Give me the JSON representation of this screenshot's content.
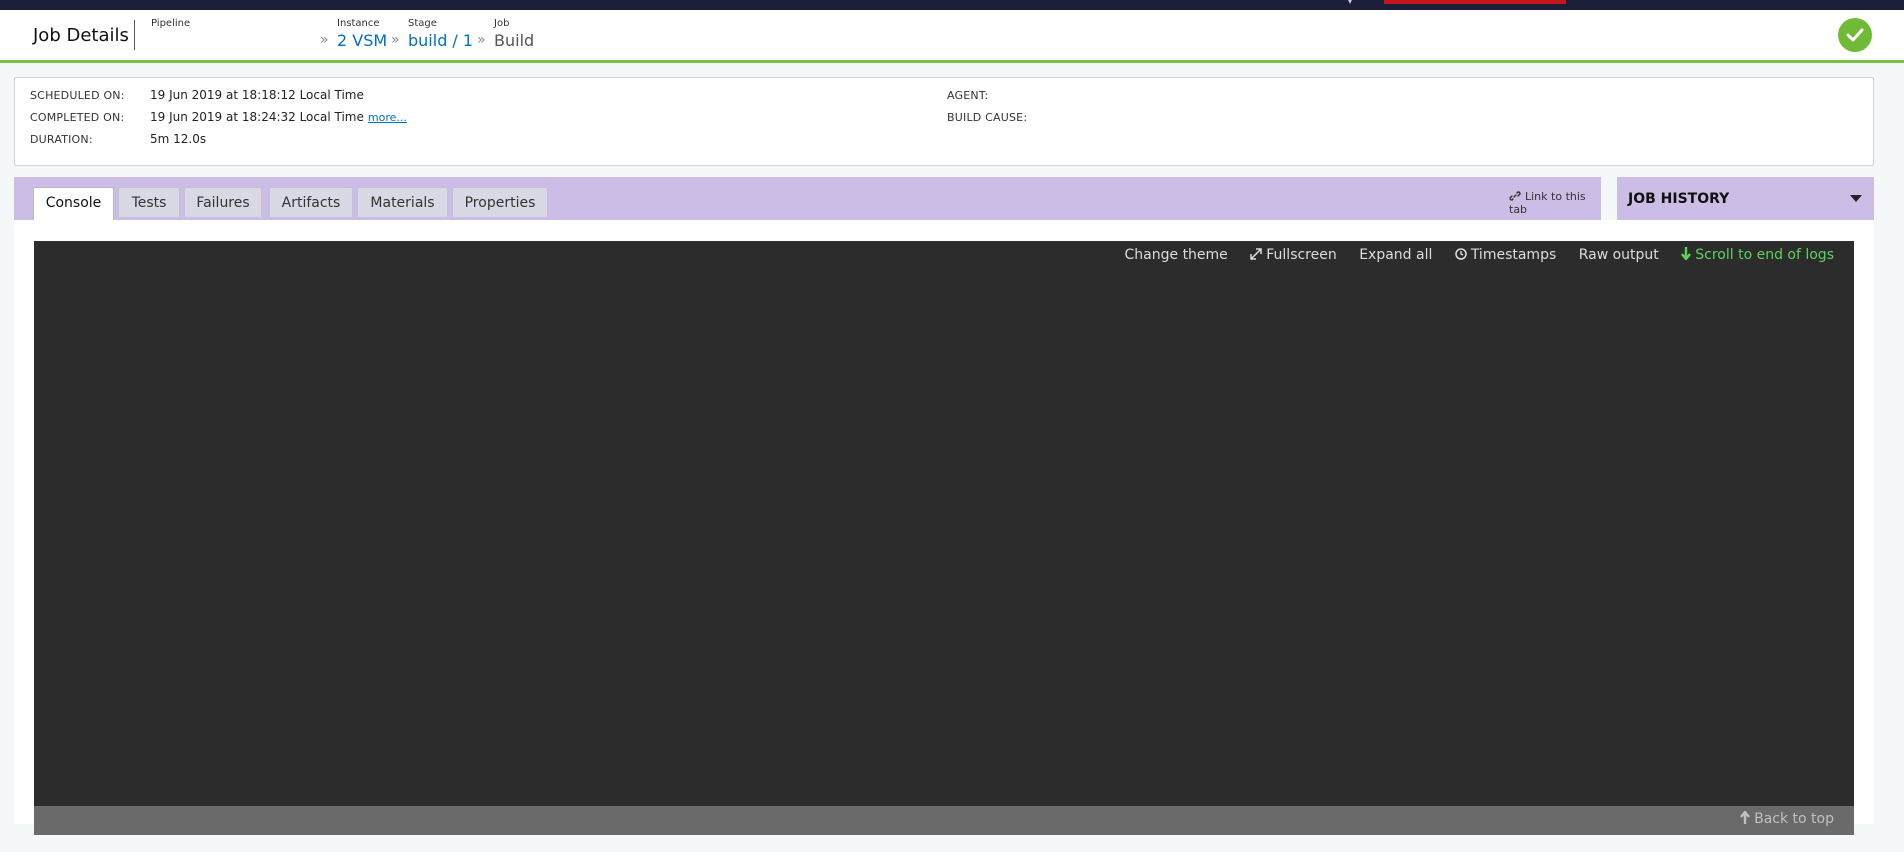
{
  "header": {
    "title": "Job Details",
    "breadcrumb": {
      "pipeline_label": "Pipeline",
      "instance_label": "Instance",
      "instance_value": "2 VSM",
      "stage_label": "Stage",
      "stage_value": "build / 1",
      "job_label": "Job",
      "job_value": "Build",
      "separator": "»"
    },
    "status": "passed",
    "status_icon": "check-icon"
  },
  "info": {
    "scheduled_label": "SCHEDULED ON:",
    "scheduled_value": "19 Jun 2019 at 18:18:12 Local Time",
    "completed_label": "COMPLETED ON:",
    "completed_value": "19 Jun 2019 at 18:24:32 Local Time",
    "more_link": "more...",
    "duration_label": "DURATION:",
    "duration_value": "5m 12.0s",
    "agent_label": "AGENT:",
    "agent_value": "",
    "build_cause_label": "BUILD CAUSE:",
    "build_cause_value": ""
  },
  "tabs": [
    {
      "label": "Console",
      "active": true
    },
    {
      "label": "Tests",
      "active": false
    },
    {
      "label": "Failures",
      "active": false
    },
    {
      "label": "Artifacts",
      "active": false
    },
    {
      "label": "Materials",
      "active": false
    },
    {
      "label": "Properties",
      "active": false
    }
  ],
  "link_to_tab": "Link to this tab",
  "job_history": {
    "label": "JOB HISTORY"
  },
  "console": {
    "change_theme": "Change theme",
    "fullscreen": "Fullscreen",
    "expand_all": "Expand all",
    "timestamps": "Timestamps",
    "raw_output": "Raw output",
    "scroll_end": "Scroll to end of logs",
    "back_to_top": "Back to top"
  },
  "colors": {
    "accent_green": "#77c043",
    "tab_bar": "#cbbde5",
    "console_bg": "#2c2c2c",
    "link_blue": "#0070c0",
    "scroll_green": "#5cd35c",
    "top_red": "#c4161c"
  }
}
